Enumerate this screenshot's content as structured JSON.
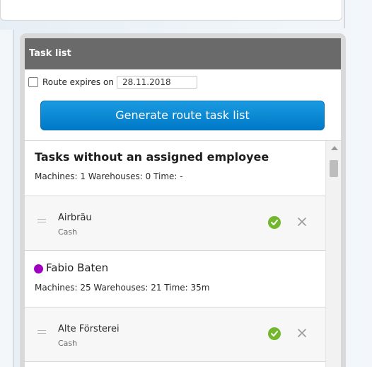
{
  "panel": {
    "title": "Task list",
    "route_label": "Route expires on",
    "route_date": "28.11.2018",
    "generate_label": "Generate route task list"
  },
  "groups": [
    {
      "title": "Tasks without an assigned employee",
      "summary": "Machines: 1 Warehouses: 0 Time: -"
    }
  ],
  "tasks": [
    {
      "name": "Airbräu",
      "sub": "Cash"
    },
    {
      "name": "Alte Försterei",
      "sub": "Cash"
    }
  ],
  "employees": [
    {
      "name": "Fabio Baten",
      "summary": "Machines: 25 Warehouses: 21 Time: 35m",
      "color": "#a000c0"
    }
  ],
  "icons": {
    "confirm": "check-icon",
    "remove": "close-icon",
    "drag": "drag-handle-icon",
    "scroll_up": "chevron-up-icon"
  },
  "colors": {
    "header": "#6a6a6a",
    "button": "#0c88d3",
    "confirm": "#72b72c",
    "employee": "#a000c0"
  }
}
